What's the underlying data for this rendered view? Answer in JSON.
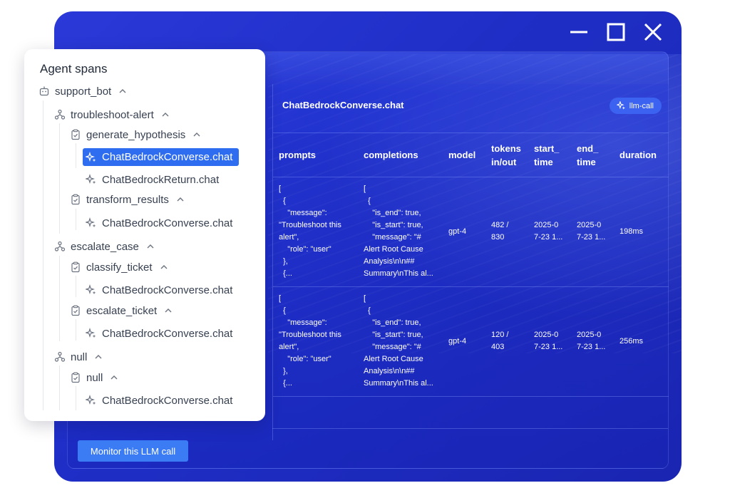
{
  "window_controls": [
    "minimize-icon",
    "maximize-icon",
    "close-icon"
  ],
  "tree": {
    "title": "Agent spans",
    "root": "support_bot",
    "items": [
      {
        "label": "troubleshoot-alert"
      },
      {
        "label": "generate_hypothesis"
      },
      {
        "label": "ChatBedrockConverse.chat",
        "selected": true
      },
      {
        "label": "ChatBedrockReturn.chat"
      },
      {
        "label": "transform_results"
      },
      {
        "label": "ChatBedrockConverse.chat"
      },
      {
        "label": "escalate_case"
      },
      {
        "label": "classify_ticket"
      },
      {
        "label": "ChatBedrockConverse.chat"
      },
      {
        "label": "escalate_ticket"
      },
      {
        "label": "ChatBedrockConverse.chat"
      },
      {
        "label": "null"
      },
      {
        "label": "null"
      },
      {
        "label": "ChatBedrockConverse.chat"
      }
    ]
  },
  "detail": {
    "title": "ChatBedrockConverse.chat",
    "chip": "llm-call",
    "columns": [
      "prompts",
      "completions",
      "model",
      "tokens\nin/out",
      "start_\ntime",
      "end_\ntime",
      "duration"
    ],
    "rows": [
      {
        "prompts": "[\n  {\n    \"message\":\n\"Troubleshoot this\nalert\",\n    \"role\": \"user\"\n  },\n  {...",
        "completions": "[\n  {\n    \"is_end\": true,\n    \"is_start\": true,\n    \"message\": \"#\nAlert Root Cause\nAnalysis\\n\\n##\nSummary\\nThis al...",
        "model": "gpt-4",
        "tokens": "482 /\n830",
        "start": "2025-0\n7-23 1...",
        "end": "2025-0\n7-23 1...",
        "duration": "198ms"
      },
      {
        "prompts": "[\n  {\n    \"message\":\n\"Troubleshoot this\nalert\",\n    \"role\": \"user\"\n  },\n  {...",
        "completions": "[\n  {\n    \"is_end\": true,\n    \"is_start\": true,\n    \"message\": \"#\nAlert Root Cause\nAnalysis\\n\\n##\nSummary\\nThis al...",
        "model": "gpt-4",
        "tokens": "120 /\n403",
        "start": "2025-0\n7-23 1...",
        "end": "2025-0\n7-23 1...",
        "duration": "256ms"
      }
    ]
  },
  "monitor_button": "Monitor this LLM call",
  "colors": {
    "window_blue": "#2235cf",
    "accent": "#2f6df0",
    "button": "#3b7cf5"
  }
}
